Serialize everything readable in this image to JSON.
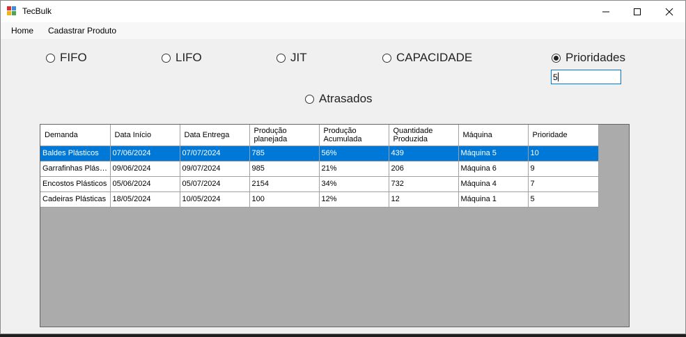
{
  "window": {
    "title": "TecBulk"
  },
  "menu": {
    "items": [
      "Home",
      "Cadastrar Produto"
    ]
  },
  "radios": {
    "fifo": "FIFO",
    "lifo": "LIFO",
    "jit": "JIT",
    "capacidade": "CAPACIDADE",
    "prioridades": "Prioridades",
    "atrasados": "Atrasados",
    "selected": "prioridades"
  },
  "priority_input": {
    "value": "5"
  },
  "grid": {
    "columns": [
      "Demanda",
      "Data Início",
      "Data Entrega",
      "Produção planejada",
      "Produção Acumulada",
      "Quantidade Produzida",
      "Máquina",
      "Prioridade"
    ],
    "rows": [
      [
        "Baldes Plásticos",
        "07/06/2024",
        "07/07/2024",
        "785",
        "56%",
        "439",
        "Máquina 5",
        "10"
      ],
      [
        "Garrafinhas Plásticas",
        "09/06/2024",
        "09/07/2024",
        "985",
        "21%",
        "206",
        "Máquina 6",
        "9"
      ],
      [
        "Encostos Plásticos",
        "05/06/2024",
        "05/07/2024",
        "2154",
        "34%",
        "732",
        "Máquina 4",
        "7"
      ],
      [
        "Cadeiras Plásticas",
        "18/05/2024",
        "10/05/2024",
        "100",
        "12%",
        "12",
        "Máquina 1",
        "5"
      ]
    ],
    "selected_row": 0
  },
  "colors": {
    "selection": "#0078d7",
    "grid_background": "#ababab"
  }
}
